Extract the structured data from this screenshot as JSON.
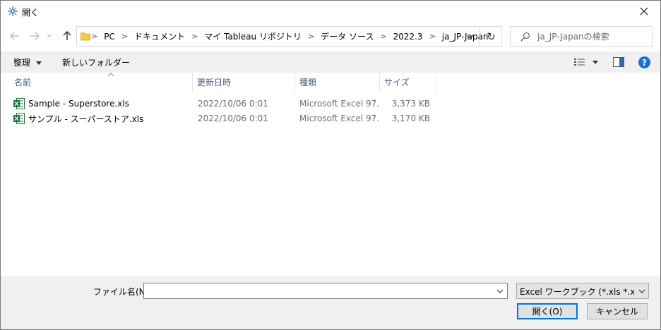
{
  "window": {
    "title": "開く"
  },
  "nav": {
    "crumbs": [
      "PC",
      "ドキュメント",
      "マイ Tableau リポジトリ",
      "データ ソース",
      "2022.3",
      "ja_JP-Japan"
    ]
  },
  "search": {
    "placeholder": "ja_JP-Japanの検索"
  },
  "toolbar": {
    "organize_label": "整理",
    "new_folder_label": "新しいフォルダー"
  },
  "columns": {
    "name": "名前",
    "date": "更新日時",
    "type": "種類",
    "size": "サイズ"
  },
  "files": [
    {
      "name": "Sample - Superstore.xls",
      "date": "2022/10/06 0:01",
      "type": "Microsoft Excel 97...",
      "size": "3,373 KB"
    },
    {
      "name": "サンプル - スーパーストア.xls",
      "date": "2022/10/06 0:01",
      "type": "Microsoft Excel 97...",
      "size": "3,170 KB"
    }
  ],
  "footer": {
    "filename_label": "ファイル名(N):",
    "filename_value": "",
    "filetype_value": "Excel ワークブック (*.xls *.xlsx *.xls",
    "open_label": "開く(O)",
    "cancel_label": "キャンセル"
  },
  "colors": {
    "accent": "#0078d7",
    "help": "#1a6fd1",
    "folder": "#f5c84c",
    "excel_green": "#1d6f42"
  }
}
